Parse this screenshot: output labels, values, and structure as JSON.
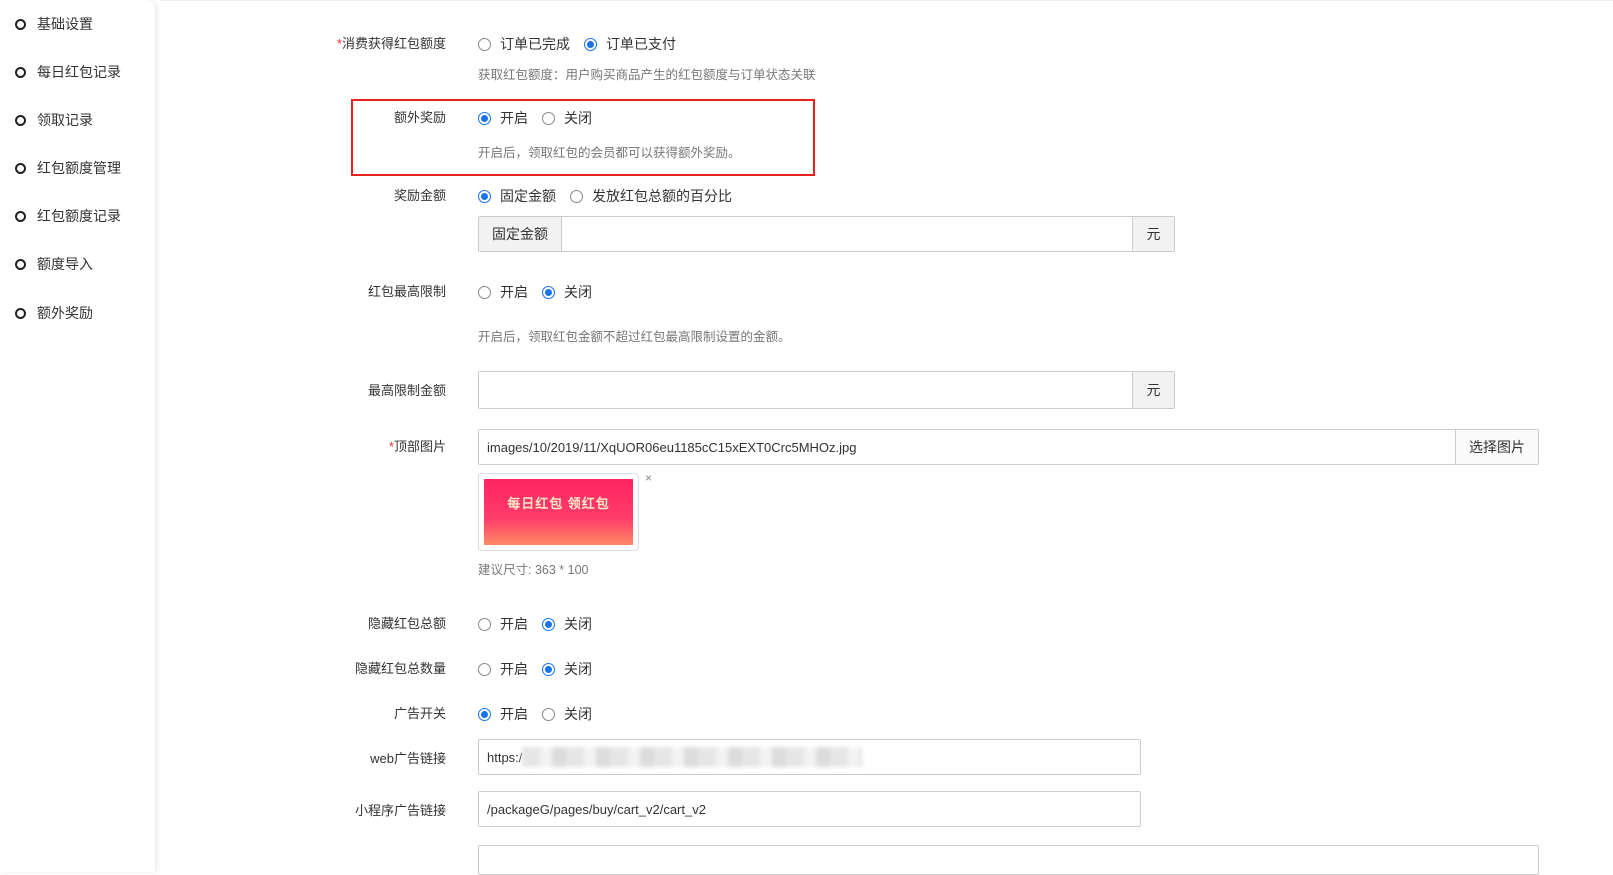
{
  "sidebar": {
    "items": [
      {
        "label": "基础设置"
      },
      {
        "label": "每日红包记录"
      },
      {
        "label": "领取记录"
      },
      {
        "label": "红包额度管理"
      },
      {
        "label": "红包额度记录"
      },
      {
        "label": "额度导入"
      },
      {
        "label": "额外奖励"
      }
    ]
  },
  "form": {
    "consume": {
      "label": "消费获得红包额度",
      "options": [
        "订单已完成",
        "订单已支付"
      ],
      "help": "获取红包额度：用户购买商品产生的红包额度与订单状态关联"
    },
    "extra": {
      "label": "额外奖励",
      "options": [
        "开启",
        "关闭"
      ],
      "help": "开启后，领取红包的会员都可以获得额外奖励。"
    },
    "amount": {
      "label": "奖励金额",
      "options": [
        "固定金额",
        "发放红包总额的百分比"
      ],
      "prefix": "固定金额",
      "value": "",
      "suffix": "元"
    },
    "maxlimit": {
      "label": "红包最高限制",
      "options": [
        "开启",
        "关闭"
      ],
      "help": "开启后，领取红包金额不超过红包最高限制设置的金额。"
    },
    "maxamount": {
      "label": "最高限制金额",
      "value": "",
      "suffix": "元"
    },
    "topimage": {
      "label": "顶部图片",
      "value": "images/10/2019/11/XqUOR06eu1185cC15xEXT0Crc5MHOz.jpg",
      "button": "选择图片",
      "banner_text": "每日红包 领红包",
      "remove": "×",
      "help": "建议尺寸: 363 * 100"
    },
    "hidetotal": {
      "label": "隐藏红包总额",
      "options": [
        "开启",
        "关闭"
      ]
    },
    "hidecount": {
      "label": "隐藏红包总数量",
      "options": [
        "开启",
        "关闭"
      ]
    },
    "ad": {
      "label": "广告开关",
      "options": [
        "开启",
        "关闭"
      ]
    },
    "weblink": {
      "label": "web广告链接",
      "value": "https:/"
    },
    "miniapp": {
      "label": "小程序广告链接",
      "value": "/packageG/pages/buy/cart_v2/cart_v2"
    }
  },
  "colors": {
    "accent": "#1a73e8",
    "highlight": "#e8211c"
  }
}
